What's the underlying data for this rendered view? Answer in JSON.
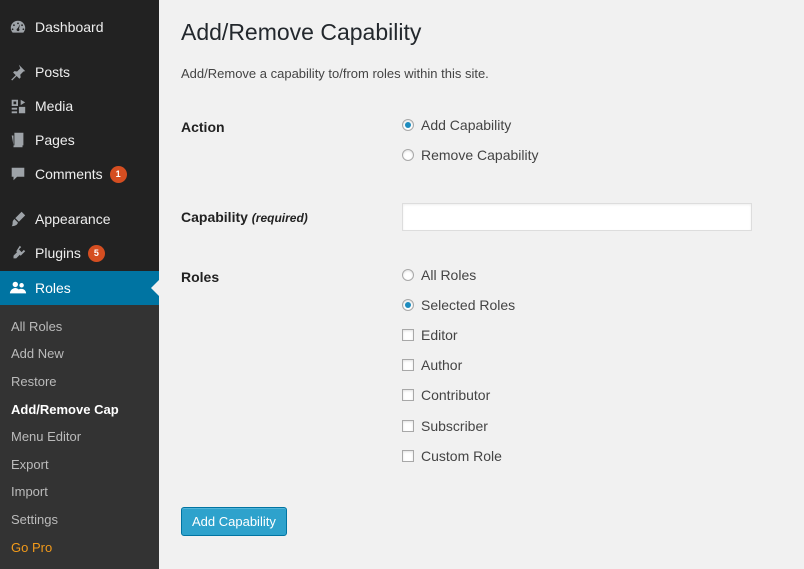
{
  "sidebar": {
    "items": [
      {
        "label": "Dashboard",
        "icon": "dashboard-icon"
      },
      {
        "label": "Posts",
        "icon": "pin-icon"
      },
      {
        "label": "Media",
        "icon": "media-icon"
      },
      {
        "label": "Pages",
        "icon": "pages-icon"
      },
      {
        "label": "Comments",
        "icon": "comments-icon",
        "badge": "1"
      },
      {
        "label": "Appearance",
        "icon": "paintbrush-icon"
      },
      {
        "label": "Plugins",
        "icon": "plugins-icon",
        "badge": "5"
      },
      {
        "label": "Roles",
        "icon": "users-icon",
        "current": true
      }
    ],
    "submenu": [
      {
        "label": "All Roles"
      },
      {
        "label": "Add New"
      },
      {
        "label": "Restore"
      },
      {
        "label": "Add/Remove Cap",
        "current": true
      },
      {
        "label": "Menu Editor"
      },
      {
        "label": "Export"
      },
      {
        "label": "Import"
      },
      {
        "label": "Settings"
      },
      {
        "label": "Go Pro"
      }
    ]
  },
  "page": {
    "title": "Add/Remove Capability",
    "description": "Add/Remove a capability to/from roles within this site."
  },
  "form": {
    "action_label": "Action",
    "action_options": [
      {
        "label": "Add Capability",
        "checked": true
      },
      {
        "label": "Remove Capability",
        "checked": false
      }
    ],
    "capability_label": "Capability",
    "capability_required": "(required)",
    "capability_value": "",
    "roles_label": "Roles",
    "roles_scope": [
      {
        "label": "All Roles",
        "checked": false
      },
      {
        "label": "Selected Roles",
        "checked": true
      }
    ],
    "roles_list": [
      {
        "label": "Editor",
        "checked": false
      },
      {
        "label": "Author",
        "checked": false
      },
      {
        "label": "Contributor",
        "checked": false
      },
      {
        "label": "Subscriber",
        "checked": false
      },
      {
        "label": "Custom Role",
        "checked": false
      }
    ],
    "submit_label": "Add Capability"
  },
  "colors": {
    "sidebar_bg": "#222222",
    "submenu_bg": "#333333",
    "accent": "#0074a2",
    "button": "#2ea2cc",
    "badge": "#d54e21",
    "go_pro": "#f29a1a"
  }
}
